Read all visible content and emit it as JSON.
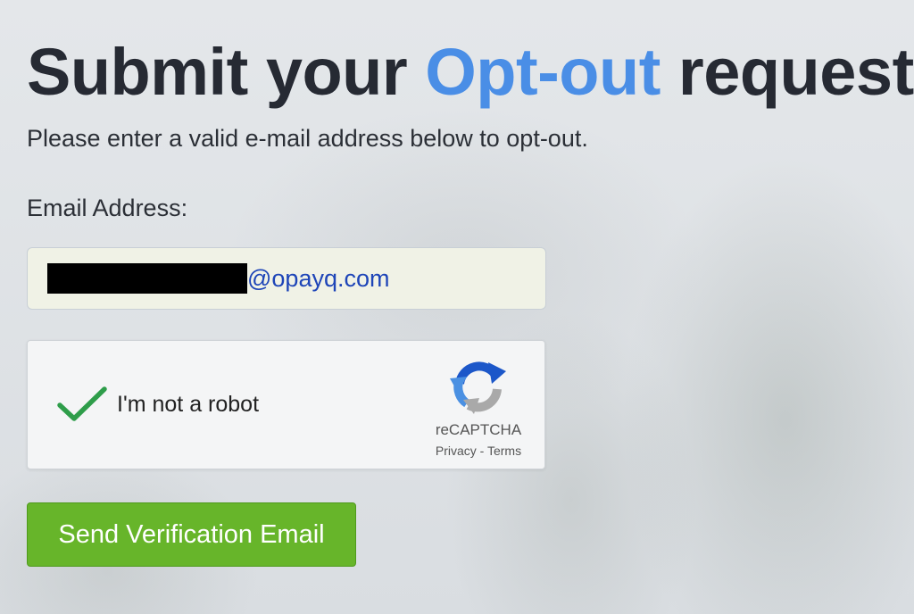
{
  "heading": {
    "part1": "Submit your ",
    "accent": "Opt-out",
    "part2": " request"
  },
  "subtitle": "Please enter a valid e-mail address below to opt-out.",
  "email_field": {
    "label": "Email Address:",
    "value_domain": "@opayq.com",
    "local_part_redacted": true
  },
  "captcha": {
    "checked": true,
    "label": "I'm not a robot",
    "brand": "reCAPTCHA",
    "links": "Privacy - Terms",
    "icon": "recaptcha-logo-icon",
    "check_icon": "checkmark-icon"
  },
  "submit_button": {
    "label": "Send Verification Email"
  },
  "colors": {
    "accent": "#4a8ee6",
    "button_green": "#67b52a",
    "heading": "#262a33",
    "email_text": "#1e45b8"
  }
}
